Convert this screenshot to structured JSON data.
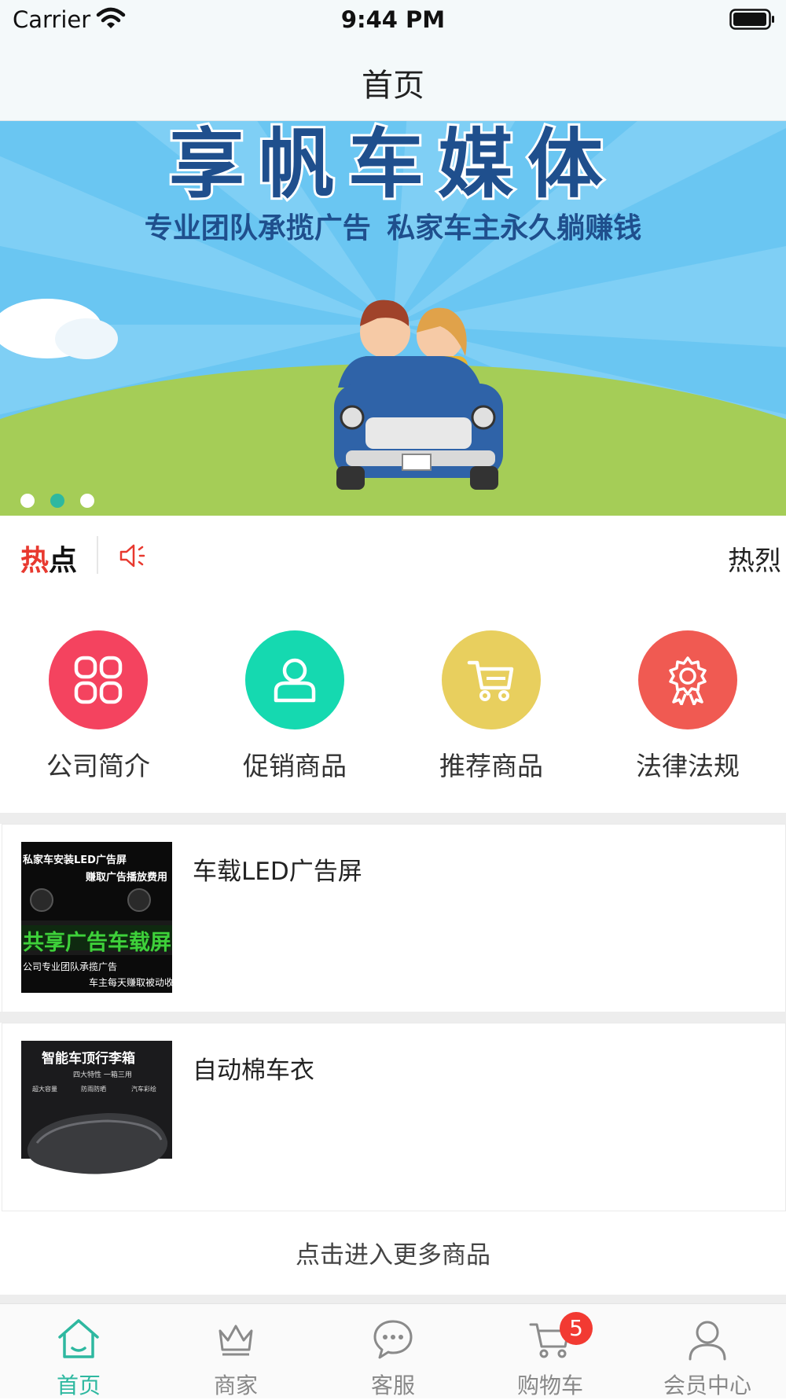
{
  "status_bar": {
    "carrier": "Carrier",
    "time": "9:44 PM"
  },
  "nav": {
    "title": "首页"
  },
  "banner": {
    "heading": "享帆车媒体",
    "subtitle": "专业团队承揽广告  私家车主永久躺赚钱",
    "dot_count": 3,
    "active_dot": 1
  },
  "ticker": {
    "label_red": "热",
    "label_black": "点",
    "text": "热烈"
  },
  "categories": [
    {
      "label": "公司简介",
      "icon": "grid-icon",
      "color": "#f4435f"
    },
    {
      "label": "促销商品",
      "icon": "user-icon",
      "color": "#15d9b0"
    },
    {
      "label": "推荐商品",
      "icon": "cart-icon",
      "color": "#e8cf5e"
    },
    {
      "label": "法律法规",
      "icon": "award-icon",
      "color": "#f05a52"
    }
  ],
  "products": [
    {
      "title": "车载LED广告屏",
      "thumb_lines": [
        "私家车安装LED广告屏",
        "赚取广告播放费用",
        "共享广告车载屏",
        "公司专业团队承揽广告",
        "车主每天赚取被动收"
      ]
    },
    {
      "title": "自动棉车衣",
      "thumb_lines": [
        "智能车顶行李箱",
        "四大特性  一箱三用",
        "超大容量",
        "防雨防晒",
        "汽车彩绘"
      ]
    }
  ],
  "more_link": "点击进入更多商品",
  "tabbar": [
    {
      "label": "首页",
      "icon": "home-icon",
      "active": true
    },
    {
      "label": "商家",
      "icon": "crown-icon",
      "active": false
    },
    {
      "label": "客服",
      "icon": "chat-icon",
      "active": false
    },
    {
      "label": "购物车",
      "icon": "shopping-cart-icon",
      "active": false,
      "badge": "5"
    },
    {
      "label": "会员中心",
      "icon": "person-icon",
      "active": false
    }
  ],
  "colors": {
    "accent": "#2eb8a0",
    "hot_red": "#e8392f",
    "badge_red": "#f23a32"
  }
}
